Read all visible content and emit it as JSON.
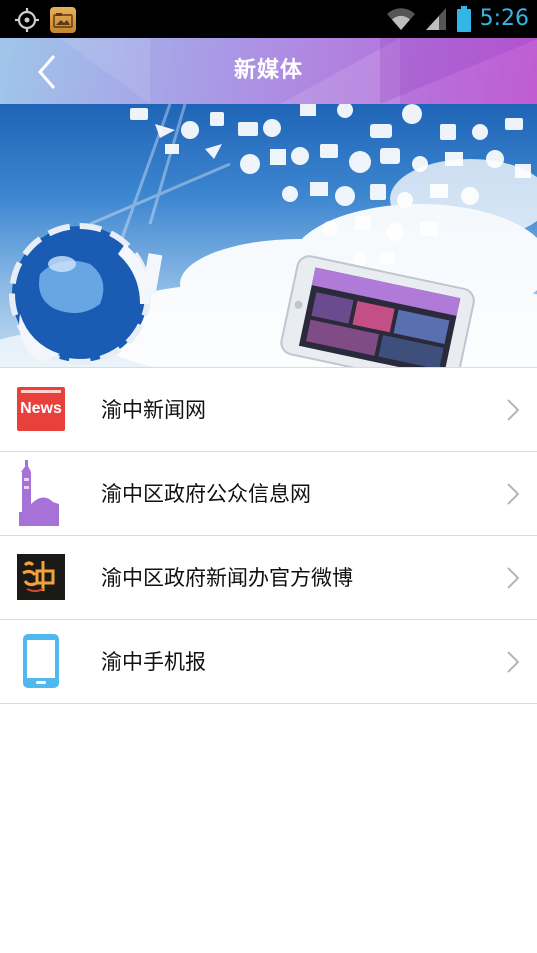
{
  "status_bar": {
    "time": "5:26",
    "icons": [
      "gps-icon",
      "photo-notification-icon",
      "wifi-icon",
      "signal-icon",
      "battery-icon"
    ],
    "accent_color": "#33b5e5"
  },
  "title_bar": {
    "title": "新媒体",
    "back_icon": "back-arrow-icon"
  },
  "banner": {
    "description_icons": [
      "globe-icon",
      "phone-icon",
      "cloud-icon"
    ]
  },
  "menu": {
    "items": [
      {
        "label": "渝中新闻网",
        "icon": "news-icon",
        "icon_text": "News"
      },
      {
        "label": "渝中区政府公众信息网",
        "icon": "tower-icon"
      },
      {
        "label": "渝中区政府新闻办官方微博",
        "icon": "weibo-logo-icon",
        "icon_text": "渝中"
      },
      {
        "label": "渝中手机报",
        "icon": "mobile-phone-icon"
      }
    ]
  },
  "colors": {
    "news_red": "#e8413c",
    "tower_purple": "#a772d8",
    "phone_blue": "#4fb8ee"
  }
}
